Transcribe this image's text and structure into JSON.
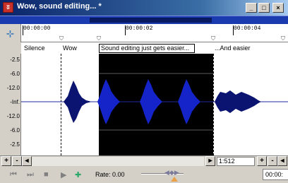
{
  "window": {
    "title": "Wow, sound editing... *",
    "app_icon": "sound-forge-icon"
  },
  "caption_buttons": {
    "minimize": "_",
    "maximize": "□",
    "close": "×"
  },
  "ruler": {
    "times": [
      "00:00:00",
      "00:00:02",
      "00:00:04"
    ]
  },
  "regions": [
    "Silence",
    "Wow",
    "Sound editing just gets easier...",
    "...And easier"
  ],
  "scale": {
    "db": [
      "-2.5",
      "-6.0",
      "-12.0",
      "-Inf.",
      "-12.0",
      "-6.0",
      "-2.5"
    ]
  },
  "scrollbar": {
    "zoom_in": "+",
    "zoom_out": "-",
    "zoom_ratio": "1:512"
  },
  "transport": {
    "rate_label": "Rate: 0.00",
    "time": "00:00:"
  },
  "colors": {
    "waveform": "#0b1470",
    "selection": "#000000",
    "overview": "#1a3bb0"
  }
}
